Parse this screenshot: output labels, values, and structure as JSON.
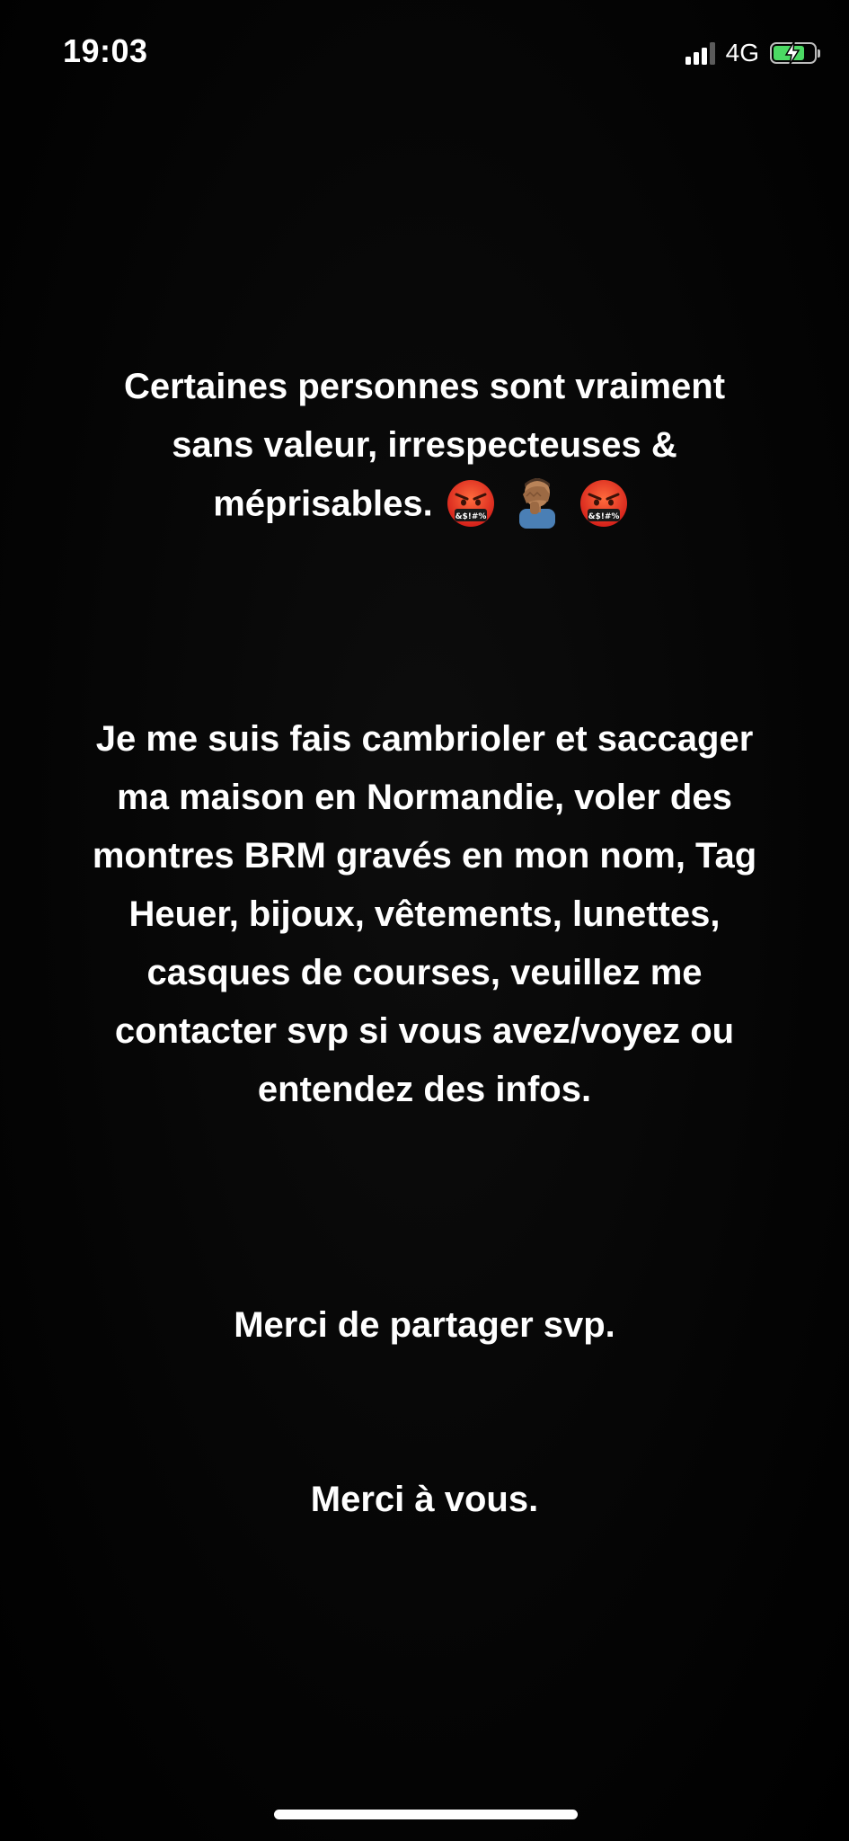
{
  "status_bar": {
    "time": "19:03",
    "network": "4G",
    "battery_level": 0.8,
    "battery_color": "#4cd964",
    "icons": [
      "signal-icon",
      "battery-icon",
      "charging-bolt-icon"
    ]
  },
  "story": {
    "paragraph1": "Certaines personnes sont vraiment\nsans valeur, irrespecteuses &\nméprisables.",
    "paragraph1_emojis": [
      "face-with-symbols-icon",
      "man-facepalming-icon",
      "face-with-symbols-icon"
    ],
    "paragraph2": "Je me suis fais cambrioler et saccager\nma maison en Normandie, voler des\nmontres BRM gravés en mon nom, Tag\nHeuer, bijoux, vêtements, lunettes,\ncasques de courses, veuillez me\ncontacter svp si vous avez/voyez ou\nentendez des infos.",
    "paragraph3": "Merci de partager svp.",
    "paragraph4": "Merci à vous."
  },
  "emoji_symbol_text": "&$!#%"
}
